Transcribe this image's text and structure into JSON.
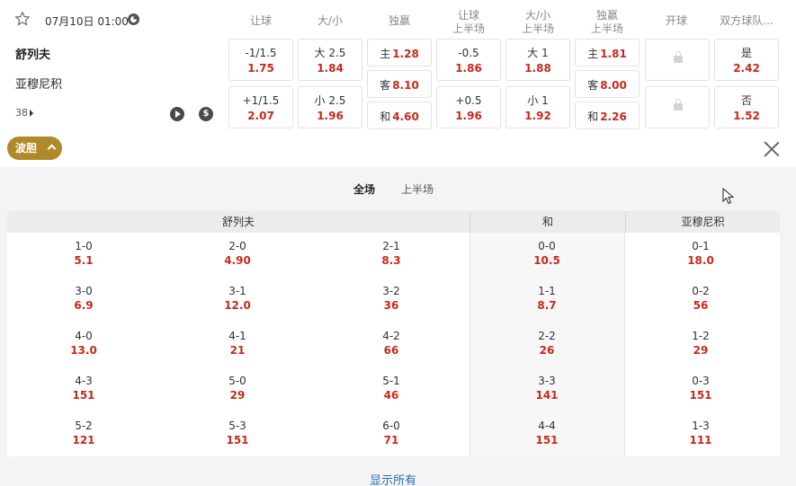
{
  "match": {
    "kickoff": "07月10日 01:00",
    "home": "舒列夫",
    "away": "亚穆尼积",
    "more_count": "38"
  },
  "columns": [
    {
      "l1": "让球",
      "l2": ""
    },
    {
      "l1": "大/小",
      "l2": ""
    },
    {
      "l1": "独赢",
      "l2": ""
    },
    {
      "l1": "让球",
      "l2": "上半场"
    },
    {
      "l1": "大/小",
      "l2": "上半场"
    },
    {
      "l1": "独赢",
      "l2": "上半场"
    },
    {
      "l1": "开球",
      "l2": ""
    },
    {
      "l1": "双方球队...",
      "l2": ""
    }
  ],
  "odds": {
    "handicap": [
      {
        "line": "-1/1.5",
        "odds": "1.75"
      },
      {
        "line": "+1/1.5",
        "odds": "2.07"
      }
    ],
    "over_under": [
      {
        "line": "大 2.5",
        "odds": "1.84"
      },
      {
        "line": "小 2.5",
        "odds": "1.96"
      }
    ],
    "moneyline": [
      {
        "line": "主",
        "odds": "1.28"
      },
      {
        "line": "客",
        "odds": "8.10"
      },
      {
        "line": "和",
        "odds": "4.60"
      }
    ],
    "handicap_1h": [
      {
        "line": "-0.5",
        "odds": "1.86"
      },
      {
        "line": "+0.5",
        "odds": "1.96"
      }
    ],
    "over_under_1h": [
      {
        "line": "大 1",
        "odds": "1.88"
      },
      {
        "line": "小 1",
        "odds": "1.92"
      }
    ],
    "moneyline_1h": [
      {
        "line": "主",
        "odds": "1.81"
      },
      {
        "line": "客",
        "odds": "8.00"
      },
      {
        "line": "和",
        "odds": "2.26"
      }
    ],
    "kickoff_team": "locked",
    "btts": [
      {
        "line": "是",
        "odds": "2.42"
      },
      {
        "line": "否",
        "odds": "1.52"
      }
    ]
  },
  "correct_score": {
    "tag": "波胆",
    "tabs": [
      "全场",
      "上半场"
    ],
    "active_tab": "全场",
    "headers": {
      "home": "舒列夫",
      "draw": "和",
      "away": "亚穆尼积"
    },
    "home_cols": [
      [
        {
          "s": "1-0",
          "o": "5.1"
        },
        {
          "s": "3-0",
          "o": "6.9"
        },
        {
          "s": "4-0",
          "o": "13.0"
        },
        {
          "s": "4-3",
          "o": "151"
        },
        {
          "s": "5-2",
          "o": "121"
        }
      ],
      [
        {
          "s": "2-0",
          "o": "4.90"
        },
        {
          "s": "3-1",
          "o": "12.0"
        },
        {
          "s": "4-1",
          "o": "21"
        },
        {
          "s": "5-0",
          "o": "29"
        },
        {
          "s": "5-3",
          "o": "151"
        }
      ],
      [
        {
          "s": "2-1",
          "o": "8.3"
        },
        {
          "s": "3-2",
          "o": "36"
        },
        {
          "s": "4-2",
          "o": "66"
        },
        {
          "s": "5-1",
          "o": "46"
        },
        {
          "s": "6-0",
          "o": "71"
        }
      ]
    ],
    "draw_col": [
      {
        "s": "0-0",
        "o": "10.5"
      },
      {
        "s": "1-1",
        "o": "8.7"
      },
      {
        "s": "2-2",
        "o": "26"
      },
      {
        "s": "3-3",
        "o": "141"
      },
      {
        "s": "4-4",
        "o": "151"
      }
    ],
    "away_col": [
      {
        "s": "0-1",
        "o": "18.0"
      },
      {
        "s": "0-2",
        "o": "56"
      },
      {
        "s": "1-2",
        "o": "29"
      },
      {
        "s": "0-3",
        "o": "151"
      },
      {
        "s": "1-3",
        "o": "111"
      }
    ],
    "show_all": "显示所有"
  },
  "icons": {
    "favorite": "star-icon",
    "clock": "clock-icon",
    "play": "play-icon",
    "money": "dollar-icon",
    "lock": "lock-icon",
    "close": "close-icon",
    "collapse": "chevron-up-icon",
    "cursor": "mouse-cursor-icon"
  },
  "colors": {
    "odds": "#c62a1c",
    "tag": "#b08a2a",
    "link": "#2b6cb0"
  }
}
